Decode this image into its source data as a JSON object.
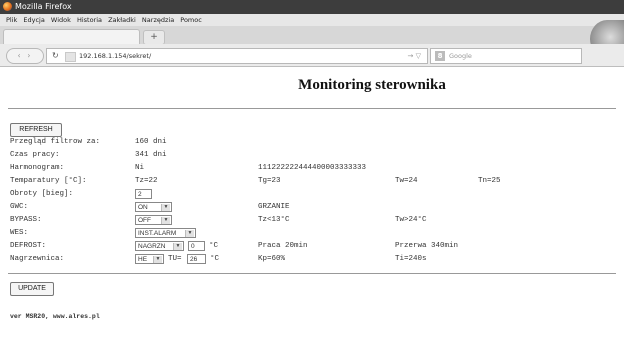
{
  "browser": {
    "window_title": "Mozilla Firefox",
    "menu": [
      "Plik",
      "Edycja",
      "Widok",
      "Historia",
      "Zakładki",
      "Narzędzia",
      "Pomoc"
    ],
    "new_tab_label": "+",
    "url": "192.168.1.154/sekret/",
    "search_placeholder": "Google",
    "search_engine": "8"
  },
  "page": {
    "title": "Monitoring sterownika",
    "refresh_label": "REFRESH",
    "update_label": "UPDATE",
    "footer": "ver MSR20, www.alres.pl",
    "rows": {
      "filtry": {
        "label": "Przegląd filtrow za:",
        "value": "160 dni"
      },
      "czas": {
        "label": "Czas pracy:",
        "value": "341 dni"
      },
      "harmonogram": {
        "label": "Harmonogram:",
        "value": "Ni",
        "schedule": "111222222444400003333333"
      },
      "temperatury": {
        "label": "Temparatury [°C]:",
        "tz": "Tz=22",
        "tg": "Tg=23",
        "tw": "Tw=24",
        "tn": "Tn=25"
      },
      "obroty": {
        "label": "Obroty [bieg]:",
        "value": "2"
      },
      "gwc": {
        "label": "GWC:",
        "select": "ON",
        "status": "GRZANIE"
      },
      "bypass": {
        "label": "BYPASS:",
        "select": "OFF",
        "cond1": "Tz<13°C",
        "cond2": "Tw>24°C"
      },
      "wes": {
        "label": "WES:",
        "select": "INST.ALARM"
      },
      "defrost": {
        "label": "DEFROST:",
        "select": "NAGRZN",
        "temp": "0",
        "unit": "°C",
        "praca": "Praca 20min",
        "przerwa": "Przerwa 340min"
      },
      "nagrzewnica": {
        "label": "Nagrzewnica:",
        "select": "HE",
        "tu_label": "TU=",
        "tu_value": "26",
        "unit": "°C",
        "kp": "Kp=60%",
        "ti": "Ti=240s"
      }
    }
  }
}
